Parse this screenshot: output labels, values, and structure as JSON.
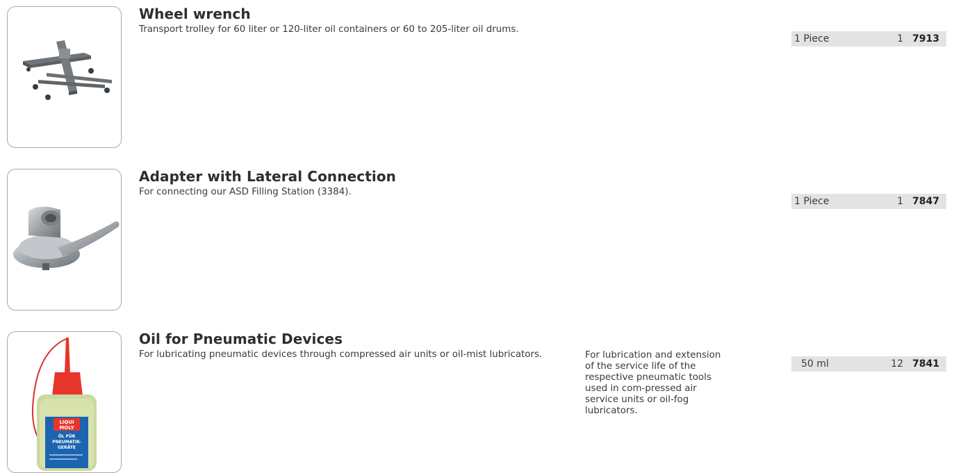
{
  "products": [
    {
      "title": "Wheel wrench",
      "description": "Transport trolley for 60 liter or 120-liter oil containers or 60 to 205-liter oil drums.",
      "note": "",
      "unit": "1 Piece",
      "quantity": "1",
      "article_number": "7913",
      "image_icon": "transport-trolley-icon"
    },
    {
      "title": "Adapter with Lateral Connection",
      "description": "For connecting our ASD Filling Station (3384).",
      "note": "",
      "unit": "1 Piece",
      "quantity": "1",
      "article_number": "7847",
      "image_icon": "adapter-lever-icon"
    },
    {
      "title": "Oil for Pneumatic Devices",
      "description": "For lubricating pneumatic devices through compressed air units or oil-mist lubricators.",
      "note": "For lubrication and extension of the service life of the respective pneumatic tools used in com-pressed air service units or oil-fog lubricators.",
      "unit": "50 ml",
      "quantity": "12",
      "article_number": "7841",
      "image_icon": "oil-bottle-icon",
      "bottle_label": [
        "LIQUI",
        "MOLY",
        "ÖL FÜR",
        "PNEUMATIK-",
        "GERÄTE"
      ]
    }
  ],
  "colors": {
    "order_bar_bg": "#e3e3e3",
    "frame_border": "#a9a9a9",
    "bottle_cap": "#e8352b",
    "bottle_label": "#1b64b0"
  }
}
